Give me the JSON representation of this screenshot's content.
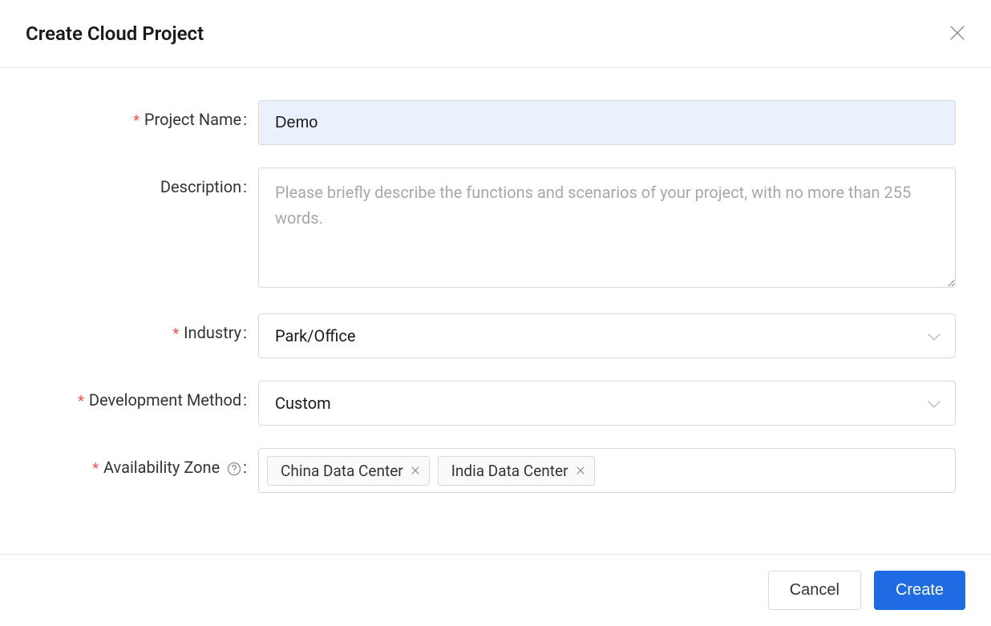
{
  "modal": {
    "title": "Create Cloud Project"
  },
  "form": {
    "project_name": {
      "label": "Project Name",
      "value": "Demo",
      "required": true
    },
    "description": {
      "label": "Description",
      "placeholder": "Please briefly describe the functions and scenarios of your project, with no more than 255 words.",
      "value": "",
      "required": false
    },
    "industry": {
      "label": "Industry",
      "value": "Park/Office",
      "required": true
    },
    "development_method": {
      "label": "Development Method",
      "value": "Custom",
      "required": true
    },
    "availability_zone": {
      "label": "Availability Zone",
      "required": true,
      "tags": [
        "China Data Center",
        "India Data Center"
      ]
    }
  },
  "footer": {
    "cancel": "Cancel",
    "create": "Create"
  }
}
